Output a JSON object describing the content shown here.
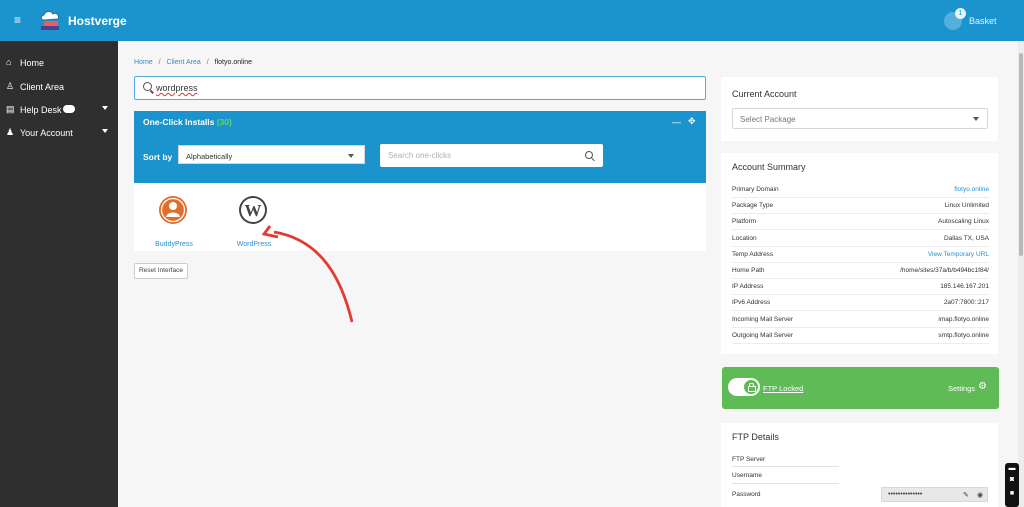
{
  "header": {
    "brand": "Hostverge",
    "basket_count": "1",
    "basket_label": "Basket",
    "menu_icon": "menu-icon"
  },
  "sidebar": {
    "items": [
      {
        "label": "Home",
        "icon": "home-icon"
      },
      {
        "label": "Client Area",
        "icon": "client-icon"
      },
      {
        "label": "Help Desk",
        "icon": "help-icon"
      },
      {
        "label": "Your Account",
        "icon": "account-icon"
      }
    ]
  },
  "breadcrumb": {
    "home": "Home",
    "client_area": "Client Area",
    "current": "flotyo.online"
  },
  "search": {
    "value": "wordpress"
  },
  "one_click": {
    "title": "One-Click Installs",
    "count": "(30)",
    "sort_label": "Sort by",
    "sort_value": "Alphabetically",
    "search_placeholder": "Search one-clicks",
    "apps": [
      {
        "label": "BuddyPress",
        "icon": "buddypress-icon"
      },
      {
        "label": "WordPress",
        "icon": "wordpress-icon"
      }
    ]
  },
  "reset_button": "Reset Interface",
  "current_account": {
    "title": "Current Account",
    "select_label": "Select Package"
  },
  "summary": {
    "title": "Account Summary",
    "rows": [
      {
        "label": "Primary Domain",
        "value": "flotyo.online",
        "link": true
      },
      {
        "label": "Package Type",
        "value": "Linux Unlimited",
        "link": false
      },
      {
        "label": "Platform",
        "value": "Autoscaling Linux",
        "link": false
      },
      {
        "label": "Location",
        "value": "Dallas TX, USA",
        "link": false
      },
      {
        "label": "Temp Address",
        "value": "View Temporary URL",
        "link": true
      },
      {
        "label": "Home Path",
        "value": "/home/sites/37a/b/b494bc1f84/",
        "link": false
      },
      {
        "label": "IP Address",
        "value": "185.146.167.201",
        "link": false
      },
      {
        "label": "IPv6 Address",
        "value": "2a07:7800::217",
        "link": false
      },
      {
        "label": "Incoming Mail Server",
        "value": "imap.flotyo.online",
        "link": false
      },
      {
        "label": "Outgoing Mail Server",
        "value": "smtp.flotyo.online",
        "link": false
      }
    ]
  },
  "ftp_lock": {
    "status": "FTP Locked",
    "settings": "Settings"
  },
  "ftp_details": {
    "title": "FTP Details",
    "server_label": "FTP Server",
    "username_label": "Username",
    "password_label": "Password",
    "password_mask": "••••••••••••••"
  },
  "colors": {
    "accent": "#1b94cd",
    "sidebar": "#2f2f2f",
    "ftp_green": "#5fbb55",
    "annotation_red": "#e23b32"
  }
}
